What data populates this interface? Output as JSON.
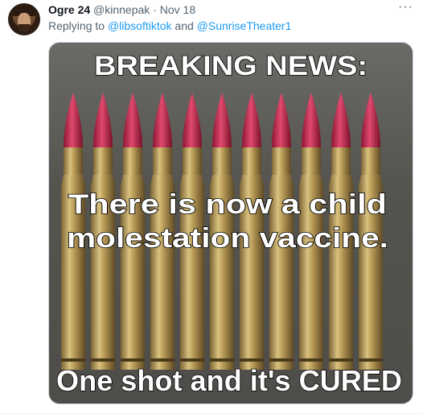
{
  "tweet": {
    "display_name": "Ogre 24",
    "handle": "@kinnepak",
    "separator": "·",
    "date": "Nov 18",
    "more_label": "···",
    "reply": {
      "prefix": "Replying to ",
      "mention_1": "@libsoftiktok",
      "conjunction": " and ",
      "mention_2": "@SunriseTheater1"
    }
  },
  "meme": {
    "headline": "BREAKING NEWS:",
    "line1": "There is now a child",
    "line2": "molestation vaccine.",
    "bottom": "One shot and it's CURED"
  },
  "colors": {
    "link": "#1d9bf0",
    "secondary_text": "#536471",
    "bullet_tip": "#c2234a",
    "bullet_casing": "#b79a55"
  },
  "icons": {
    "more": "more-horizontal-icon"
  }
}
